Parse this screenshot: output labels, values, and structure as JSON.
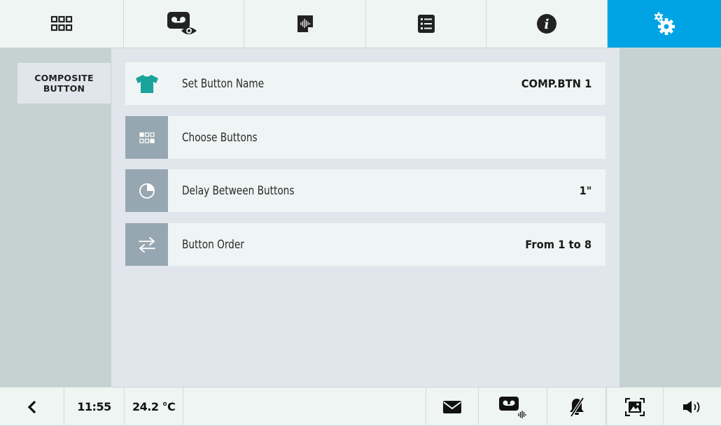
{
  "top_tabs": [
    {
      "name": "grid-icon"
    },
    {
      "name": "answering-machine-view-icon"
    },
    {
      "name": "audio-message-icon"
    },
    {
      "name": "list-icon"
    },
    {
      "name": "info-icon"
    },
    {
      "name": "settings-gears-icon",
      "active": true
    }
  ],
  "accent_color": "#00a4e4",
  "sidebar": {
    "title": "COMPOSITE\nBUTTON"
  },
  "rows": [
    {
      "icon": "tshirt-icon",
      "label": "Set Button Name",
      "value": "COMP.BTN 1"
    },
    {
      "icon": "buttons-grid-icon",
      "label": "Choose Buttons",
      "value": ""
    },
    {
      "icon": "timer-icon",
      "label": "Delay Between Buttons",
      "value": "1\""
    },
    {
      "icon": "swap-arrows-icon",
      "label": "Button Order",
      "value": "From 1 to 8"
    }
  ],
  "bottom": {
    "time": "11:55",
    "temperature": "24.2 °C"
  }
}
